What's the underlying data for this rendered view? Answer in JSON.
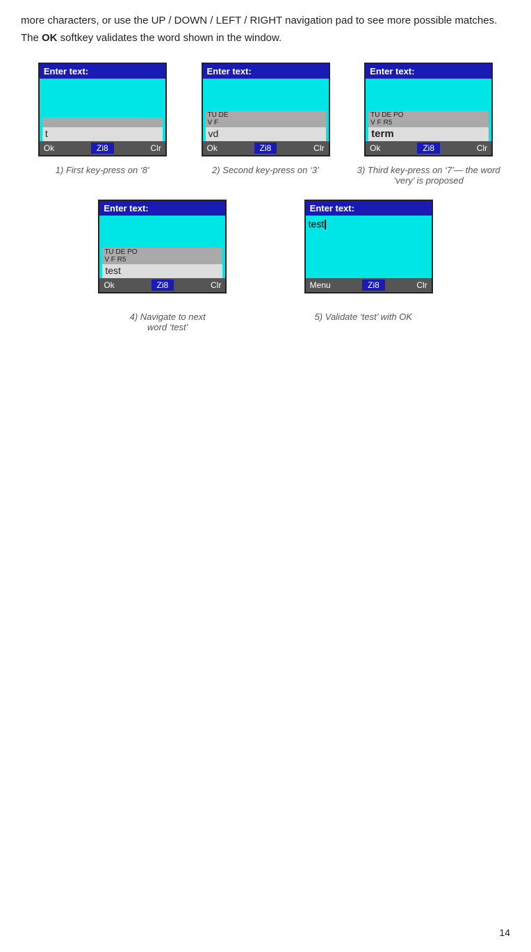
{
  "intro": {
    "text1": "more characters, or use the UP / DOWN / LEFT / RIGHT navigation pad to see more possible matches.  The ",
    "ok_label": "OK",
    "text2": " softkey validates the word shown in the window."
  },
  "screens_row1": [
    {
      "id": "screen1",
      "title": "Enter text:",
      "suggest_bar": "",
      "input_word": "t",
      "input_bold": false,
      "softkey_left": "Ok",
      "softkey_mid": "Zi8",
      "softkey_right": "Clr"
    },
    {
      "id": "screen2",
      "title": "Enter text:",
      "suggest_bar": "TU DE\nV F",
      "input_word": "vd",
      "input_bold": false,
      "softkey_left": "Ok",
      "softkey_mid": "Zi8",
      "softkey_right": "Clr"
    },
    {
      "id": "screen3",
      "title": "Enter text:",
      "suggest_bar": "TU DE PO\nV F R5",
      "input_word": "term",
      "input_bold": true,
      "softkey_left": "Ok",
      "softkey_mid": "Zi8",
      "softkey_right": "Clr"
    }
  ],
  "captions_row1": [
    "1) First key-press on ‘8’",
    "2) Second key-press on ‘3’",
    "3) Third key-press on ‘7’— the word ‘very’ is proposed"
  ],
  "screens_row2": [
    {
      "id": "screen4",
      "title": "Enter text:",
      "suggest_bar": "TU DE PO\nV F R5",
      "input_word": "test",
      "input_bold": false,
      "softkey_left": "Ok",
      "softkey_mid": "Zi8",
      "softkey_right": "Clr"
    },
    {
      "id": "screen5",
      "title": "Enter text:",
      "content_text": "test",
      "show_cursor": true,
      "suggest_bar": "",
      "input_word": "",
      "softkey_left": "Menu",
      "softkey_mid": "Zi8",
      "softkey_right": "Clr"
    }
  ],
  "captions_row2": [
    "4) Navigate to next word ‘test’",
    "5) Validate ‘test’ with OK"
  ],
  "page_number": "14"
}
